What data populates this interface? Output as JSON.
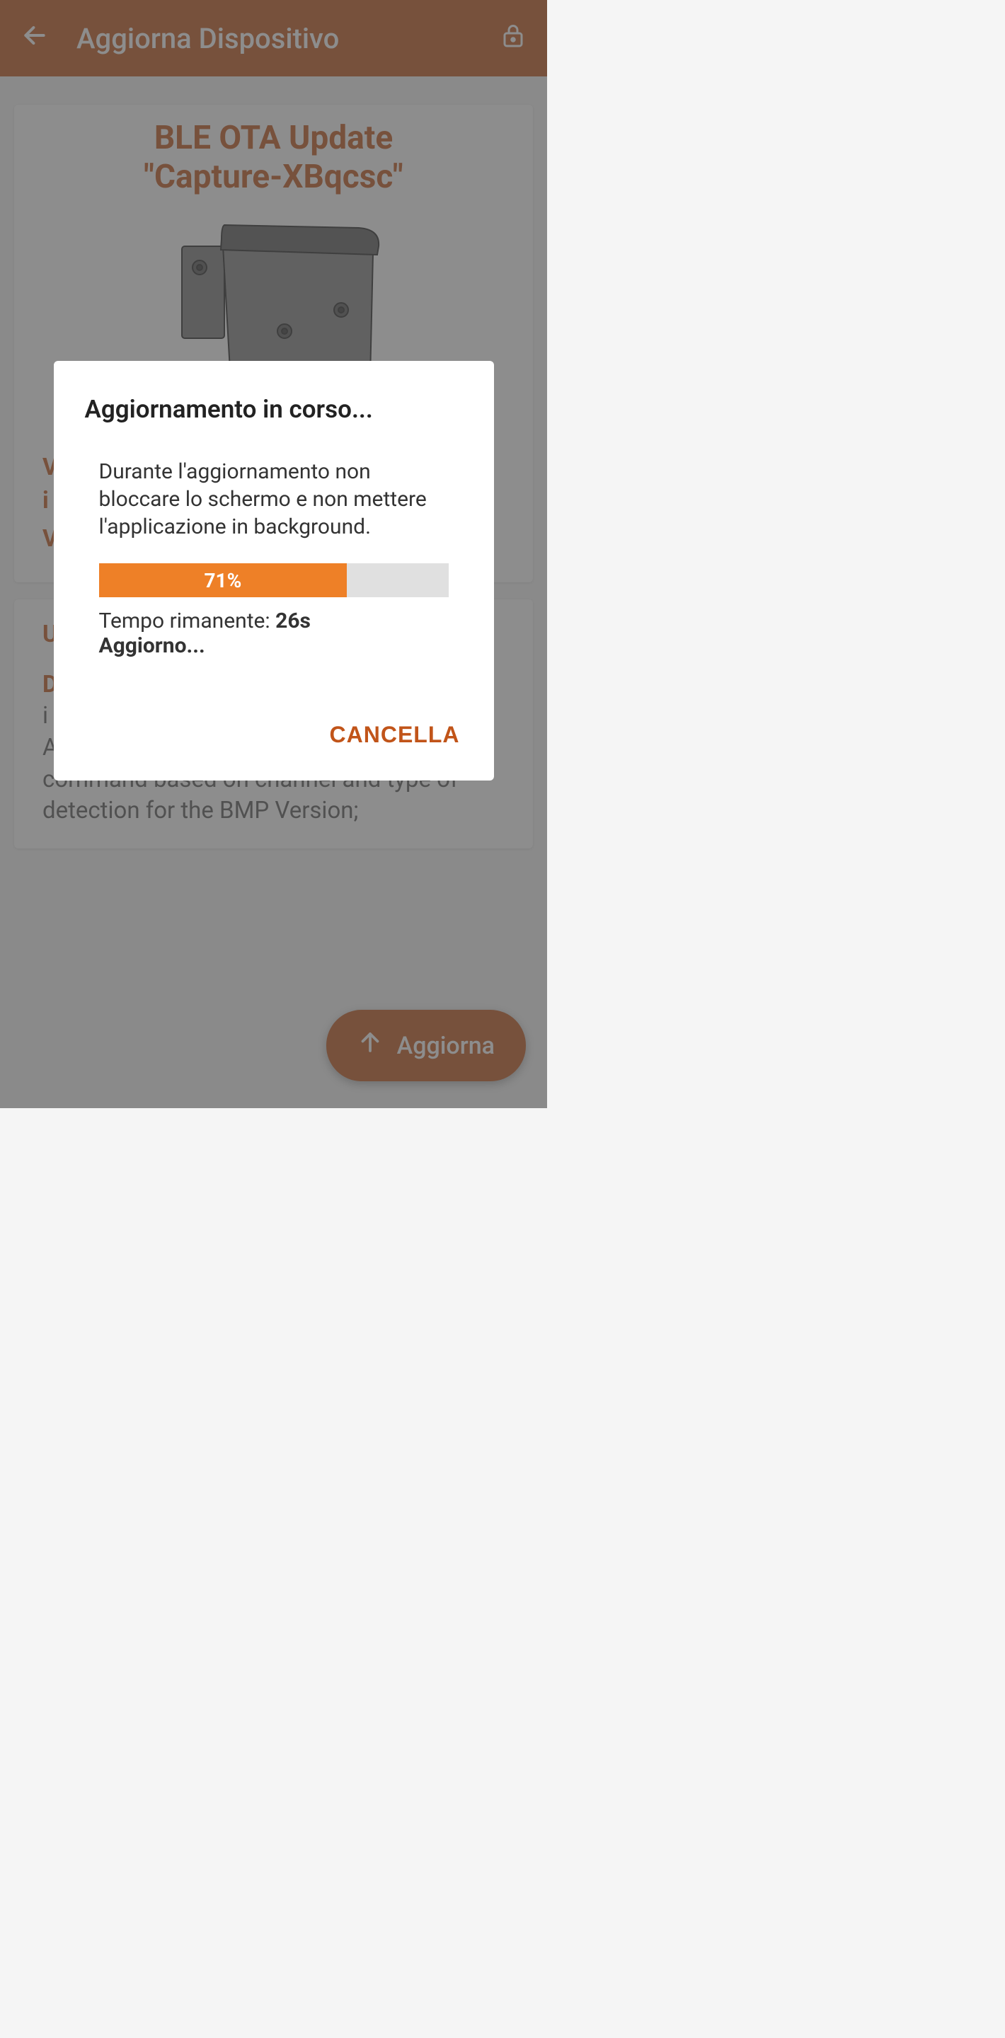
{
  "header": {
    "title": "Aggiorna Dispositivo"
  },
  "card1": {
    "title_line1": "BLE OTA Update",
    "title_line2": "\"Capture-XBqcsc\"",
    "version_installed_label": "V",
    "version_installed_line2": "i",
    "version_available_label": "V"
  },
  "card2": {
    "update_label": "U",
    "description_label": "D",
    "description_text_line1": "i",
    "description_text": "Added BLE Commands for forcing a command based on channel and type of detection for the BMP Version;"
  },
  "fab": {
    "label": "Aggiorna"
  },
  "dialog": {
    "title": "Aggiornamento in corso...",
    "message": "Durante l'aggiornamento non bloccare lo schermo e non mettere l'applicazione in background.",
    "progress_percent": 71,
    "progress_label": "71%",
    "time_remaining_prefix": "Tempo rimanente: ",
    "time_remaining_value": "26s",
    "updating_label": "Aggiorno...",
    "cancel_label": "CANCELLA"
  }
}
